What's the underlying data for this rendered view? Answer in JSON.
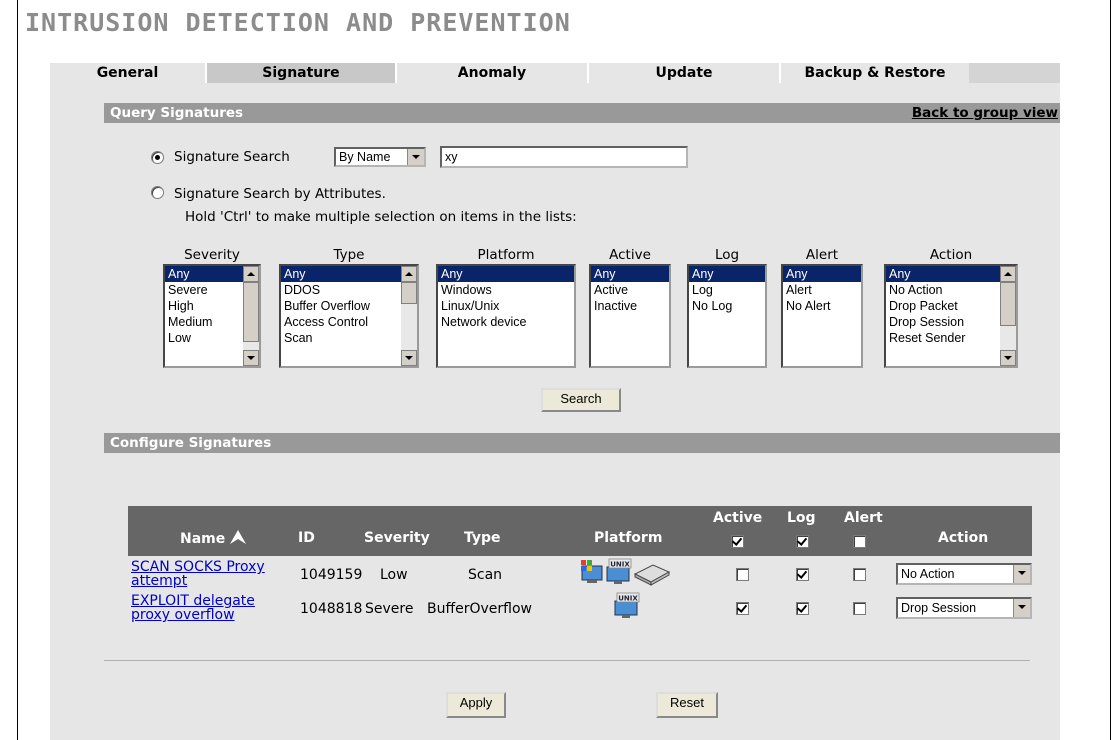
{
  "page": {
    "title": "INTRUSION DETECTION AND PREVENTION"
  },
  "tabs": [
    {
      "label": "General"
    },
    {
      "label": "Signature"
    },
    {
      "label": "Anomaly"
    },
    {
      "label": "Update"
    },
    {
      "label": "Backup & Restore"
    }
  ],
  "active_tab": "Signature",
  "query": {
    "section_title": "Query Signatures",
    "back_link": "Back to group view",
    "search_by_label": "Signature Search",
    "search_mode_selected": "By Name",
    "search_text": "xy",
    "attr_search_label": "Signature Search by Attributes.",
    "hint": "Hold 'Ctrl' to make multiple selection on items in the lists:",
    "lists": {
      "severity": {
        "header": "Severity",
        "options": [
          "Any",
          "Severe",
          "High",
          "Medium",
          "Low"
        ],
        "selected": "Any"
      },
      "type": {
        "header": "Type",
        "options": [
          "Any",
          "DDOS",
          "Buffer Overflow",
          "Access Control",
          "Scan"
        ],
        "selected": "Any"
      },
      "platform": {
        "header": "Platform",
        "options": [
          "Any",
          "Windows",
          "Linux/Unix",
          "Network device"
        ],
        "selected": "Any"
      },
      "active": {
        "header": "Active",
        "options": [
          "Any",
          "Active",
          "Inactive"
        ],
        "selected": "Any"
      },
      "log": {
        "header": "Log",
        "options": [
          "Any",
          "Log",
          "No Log"
        ],
        "selected": "Any"
      },
      "alert": {
        "header": "Alert",
        "options": [
          "Any",
          "Alert",
          "No Alert"
        ],
        "selected": "Any"
      },
      "action": {
        "header": "Action",
        "options": [
          "Any",
          "No Action",
          "Drop Packet",
          "Drop Session",
          "Reset Sender"
        ],
        "selected": "Any"
      }
    },
    "search_button": "Search"
  },
  "configure": {
    "section_title": "Configure Signatures",
    "columns": {
      "name": "Name",
      "id": "ID",
      "severity": "Severity",
      "type": "Type",
      "platform": "Platform",
      "active": "Active",
      "log": "Log",
      "alert": "Alert",
      "action": "Action"
    },
    "header_checks": {
      "active": true,
      "log": true,
      "alert": false
    },
    "rows": [
      {
        "name": "SCAN SOCKS Proxy attempt",
        "id": "1049159",
        "severity": "Low",
        "type": "Scan",
        "platform": [
          "windows-icon",
          "unix-icon",
          "network-device-icon"
        ],
        "active": false,
        "log": true,
        "alert": false,
        "action": "No Action"
      },
      {
        "name": "EXPLOIT delegate proxy overflow",
        "id": "1048818",
        "severity": "Severe",
        "type": "BufferOverflow",
        "platform": [
          "unix-icon"
        ],
        "active": true,
        "log": true,
        "alert": false,
        "action": "Drop Session"
      }
    ]
  },
  "buttons": {
    "apply": "Apply",
    "reset": "Reset"
  },
  "colors": {
    "link": "#0000cc",
    "section_bar": "#999999",
    "table_header": "#666666",
    "selection": "#0a246a"
  }
}
